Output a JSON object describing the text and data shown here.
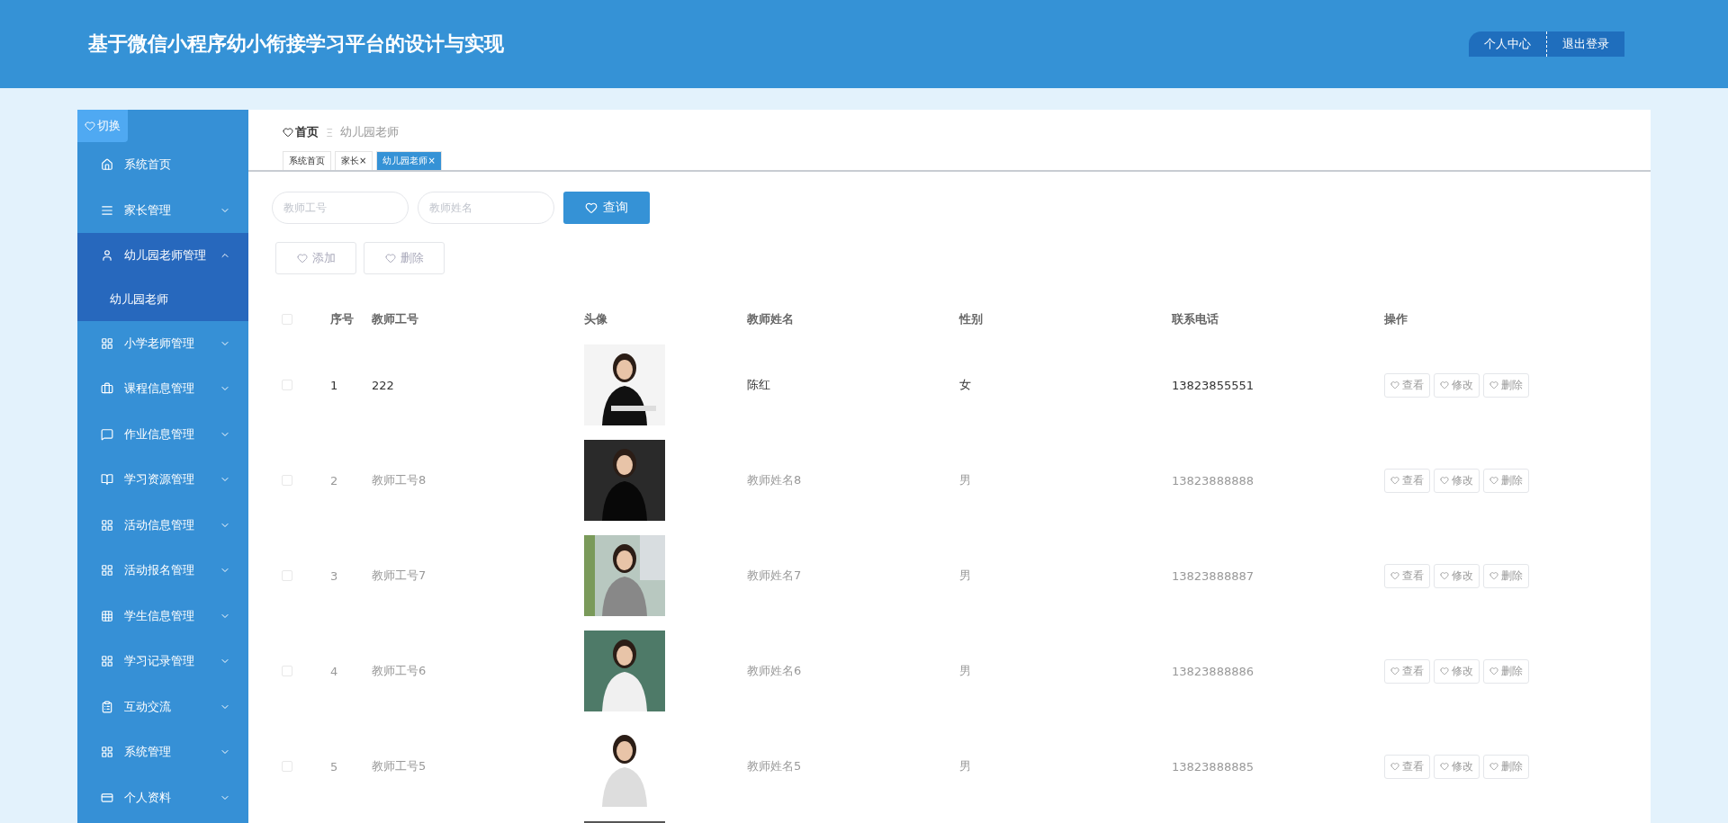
{
  "header": {
    "title": "基于微信小程序幼小衔接学习平台的设计与实现",
    "links": [
      {
        "label": "个人中心"
      },
      {
        "label": "退出登录"
      }
    ]
  },
  "sidebar": {
    "toggle": "切换",
    "items": [
      {
        "label": "系统首页",
        "expanded": false,
        "has_arrow": false
      },
      {
        "label": "家长管理",
        "expanded": false,
        "has_arrow": true
      },
      {
        "label": "幼儿园老师管理",
        "expanded": true,
        "has_arrow": true,
        "children": [
          {
            "label": "幼儿园老师"
          }
        ]
      },
      {
        "label": "小学老师管理",
        "expanded": false,
        "has_arrow": true
      },
      {
        "label": "课程信息管理",
        "expanded": false,
        "has_arrow": true
      },
      {
        "label": "作业信息管理",
        "expanded": false,
        "has_arrow": true
      },
      {
        "label": "学习资源管理",
        "expanded": false,
        "has_arrow": true
      },
      {
        "label": "活动信息管理",
        "expanded": false,
        "has_arrow": true
      },
      {
        "label": "活动报名管理",
        "expanded": false,
        "has_arrow": true
      },
      {
        "label": "学生信息管理",
        "expanded": false,
        "has_arrow": true
      },
      {
        "label": "学习记录管理",
        "expanded": false,
        "has_arrow": true
      },
      {
        "label": "互动交流",
        "expanded": false,
        "has_arrow": true
      },
      {
        "label": "系统管理",
        "expanded": false,
        "has_arrow": true
      },
      {
        "label": "个人资料",
        "expanded": false,
        "has_arrow": true
      }
    ]
  },
  "breadcrumb": {
    "home": "首页",
    "separator": "Ξ",
    "current": "幼儿园老师"
  },
  "tabs": [
    {
      "label": "系统首页",
      "closable": false,
      "selected": false
    },
    {
      "label": "家长",
      "closable": true,
      "selected": false
    },
    {
      "label": "幼儿园老师",
      "closable": true,
      "selected": true
    }
  ],
  "close_mark": "×",
  "search": {
    "fields": [
      {
        "placeholder": "教师工号"
      },
      {
        "placeholder": "教师姓名"
      }
    ],
    "button": "查询"
  },
  "toolbar": [
    "添加",
    "删除"
  ],
  "table": {
    "columns": [
      "序号",
      "教师工号",
      "头像",
      "教师姓名",
      "性别",
      "联系电话",
      "操作"
    ],
    "header_checked": false,
    "rows": [
      {
        "index": "1",
        "teacher_id": "222",
        "photo": {
          "kind": "picture"
        },
        "name": "陈红",
        "gender": "女",
        "phone": "13823855551",
        "checked": false,
        "highlighted": true,
        "actions": [
          "查看",
          "修改",
          "删除"
        ]
      },
      {
        "index": "2",
        "teacher_id": "教师工号8",
        "photo": {
          "kind": "picture"
        },
        "name": "教师姓名8",
        "gender": "男",
        "phone": "13823888888",
        "checked": false,
        "highlighted": false,
        "actions": [
          "查看",
          "修改",
          "删除"
        ]
      },
      {
        "index": "3",
        "teacher_id": "教师工号7",
        "photo": {
          "kind": "picture"
        },
        "name": "教师姓名7",
        "gender": "男",
        "phone": "13823888887",
        "checked": false,
        "highlighted": false,
        "actions": [
          "查看",
          "修改",
          "删除"
        ]
      },
      {
        "index": "4",
        "teacher_id": "教师工号6",
        "photo": {
          "kind": "picture"
        },
        "name": "教师姓名6",
        "gender": "男",
        "phone": "13823888886",
        "checked": false,
        "highlighted": false,
        "actions": [
          "查看",
          "修改",
          "删除"
        ]
      },
      {
        "index": "5",
        "teacher_id": "教师工号5",
        "photo": {
          "kind": "picture"
        },
        "name": "教师姓名5",
        "gender": "男",
        "phone": "13823888885",
        "checked": false,
        "highlighted": false,
        "actions": [
          "查看",
          "修改",
          "删除"
        ]
      },
      {
        "photo": {
          "kind": "picture"
        }
      }
    ]
  }
}
